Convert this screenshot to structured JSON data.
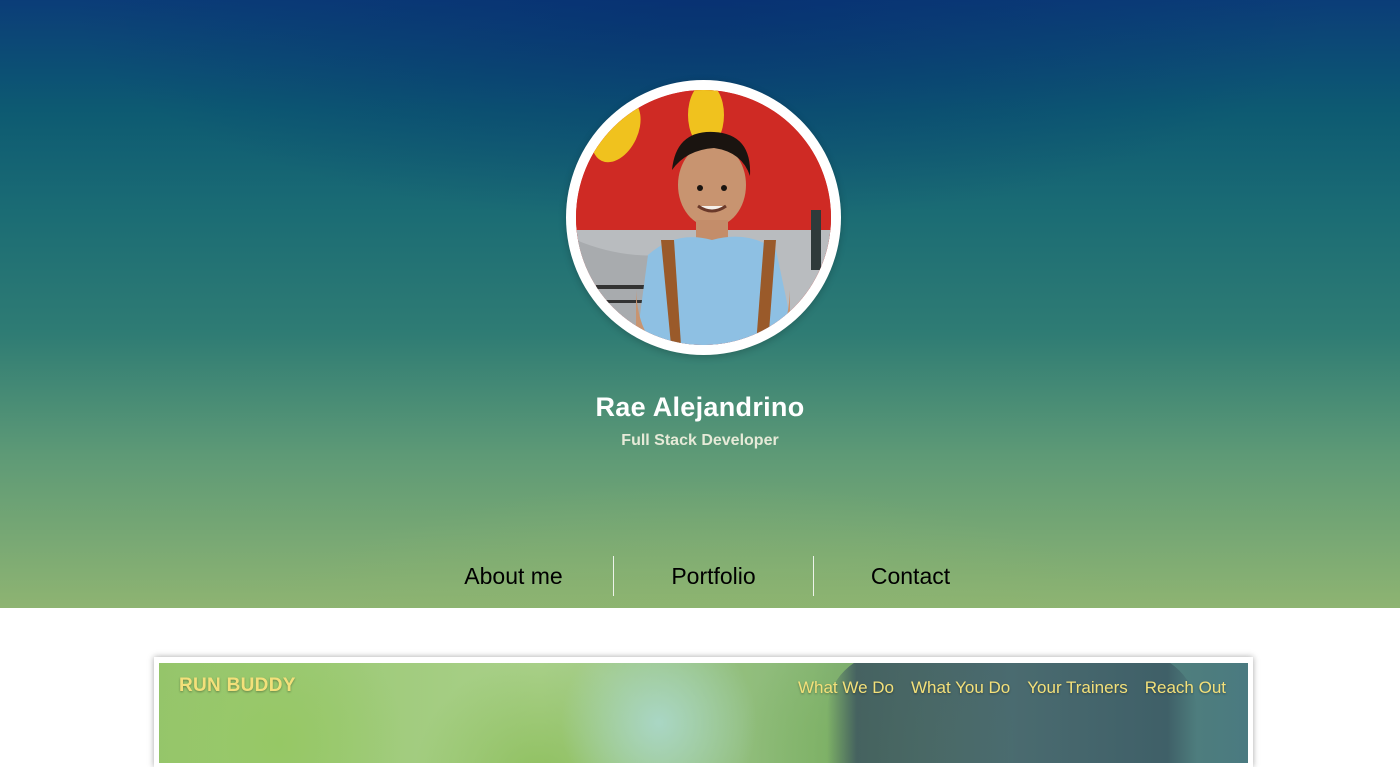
{
  "profile": {
    "name": "Rae Alejandrino",
    "title": "Full Stack Developer",
    "avatar_icon": "profile-photo"
  },
  "nav": {
    "items": [
      "About me",
      "Portfolio",
      "Contact"
    ]
  },
  "project": {
    "brand": "RUN BUDDY",
    "nav_items": [
      "What We Do",
      "What You Do",
      "Your Trainers",
      "Reach Out"
    ]
  },
  "colors": {
    "hero_top": "#0b3d78",
    "hero_bottom": "#8eb472",
    "project_accent": "#f3e07a"
  }
}
